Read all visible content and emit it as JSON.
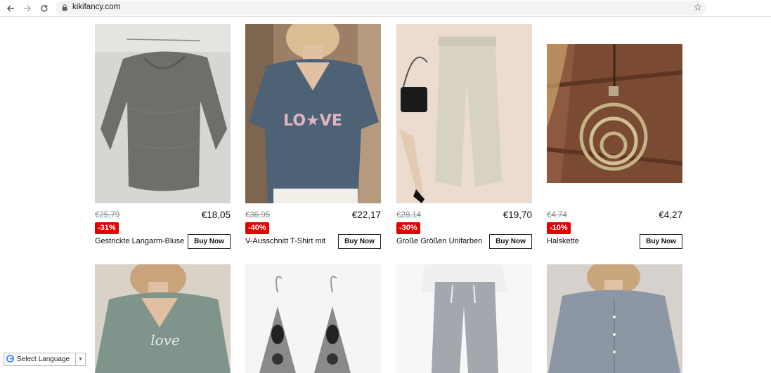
{
  "browser": {
    "url": "kikifancy.com",
    "back_icon": "arrow-left-icon",
    "forward_icon": "arrow-right-icon",
    "reload_icon": "reload-icon",
    "bookmark_icon": "star-icon"
  },
  "products": [
    {
      "old_price": "€25,79",
      "price": "€18,05",
      "discount": "-31%",
      "title": "Gestrickte Langarm-Bluse",
      "buy_label": "Buy Now",
      "image": "grey knit sweater"
    },
    {
      "old_price": "€36,95",
      "price": "€22,17",
      "discount": "-40%",
      "title": "V-Ausschnitt T-Shirt mit",
      "buy_label": "Buy Now",
      "image": "blue love t-shirt"
    },
    {
      "old_price": "€28,14",
      "price": "€19,70",
      "discount": "-30%",
      "title": "Große Größen Unifarben",
      "buy_label": "Buy Now",
      "image": "beige wide trousers"
    },
    {
      "old_price": "€4,74",
      "price": "€4,27",
      "discount": "-10%",
      "title": "Halskette",
      "buy_label": "Buy Now",
      "image": "ring pendant necklace"
    },
    {
      "image": "green v-neck t-shirt"
    },
    {
      "image": "silver drop earrings"
    },
    {
      "image": "grey linen trousers"
    },
    {
      "image": "grey shirt dress"
    }
  ],
  "language_widget": {
    "label": "Select Language",
    "brand": "G"
  },
  "colors": {
    "discount_badge": "#e50000",
    "omnibox": "#f1f3f4"
  }
}
